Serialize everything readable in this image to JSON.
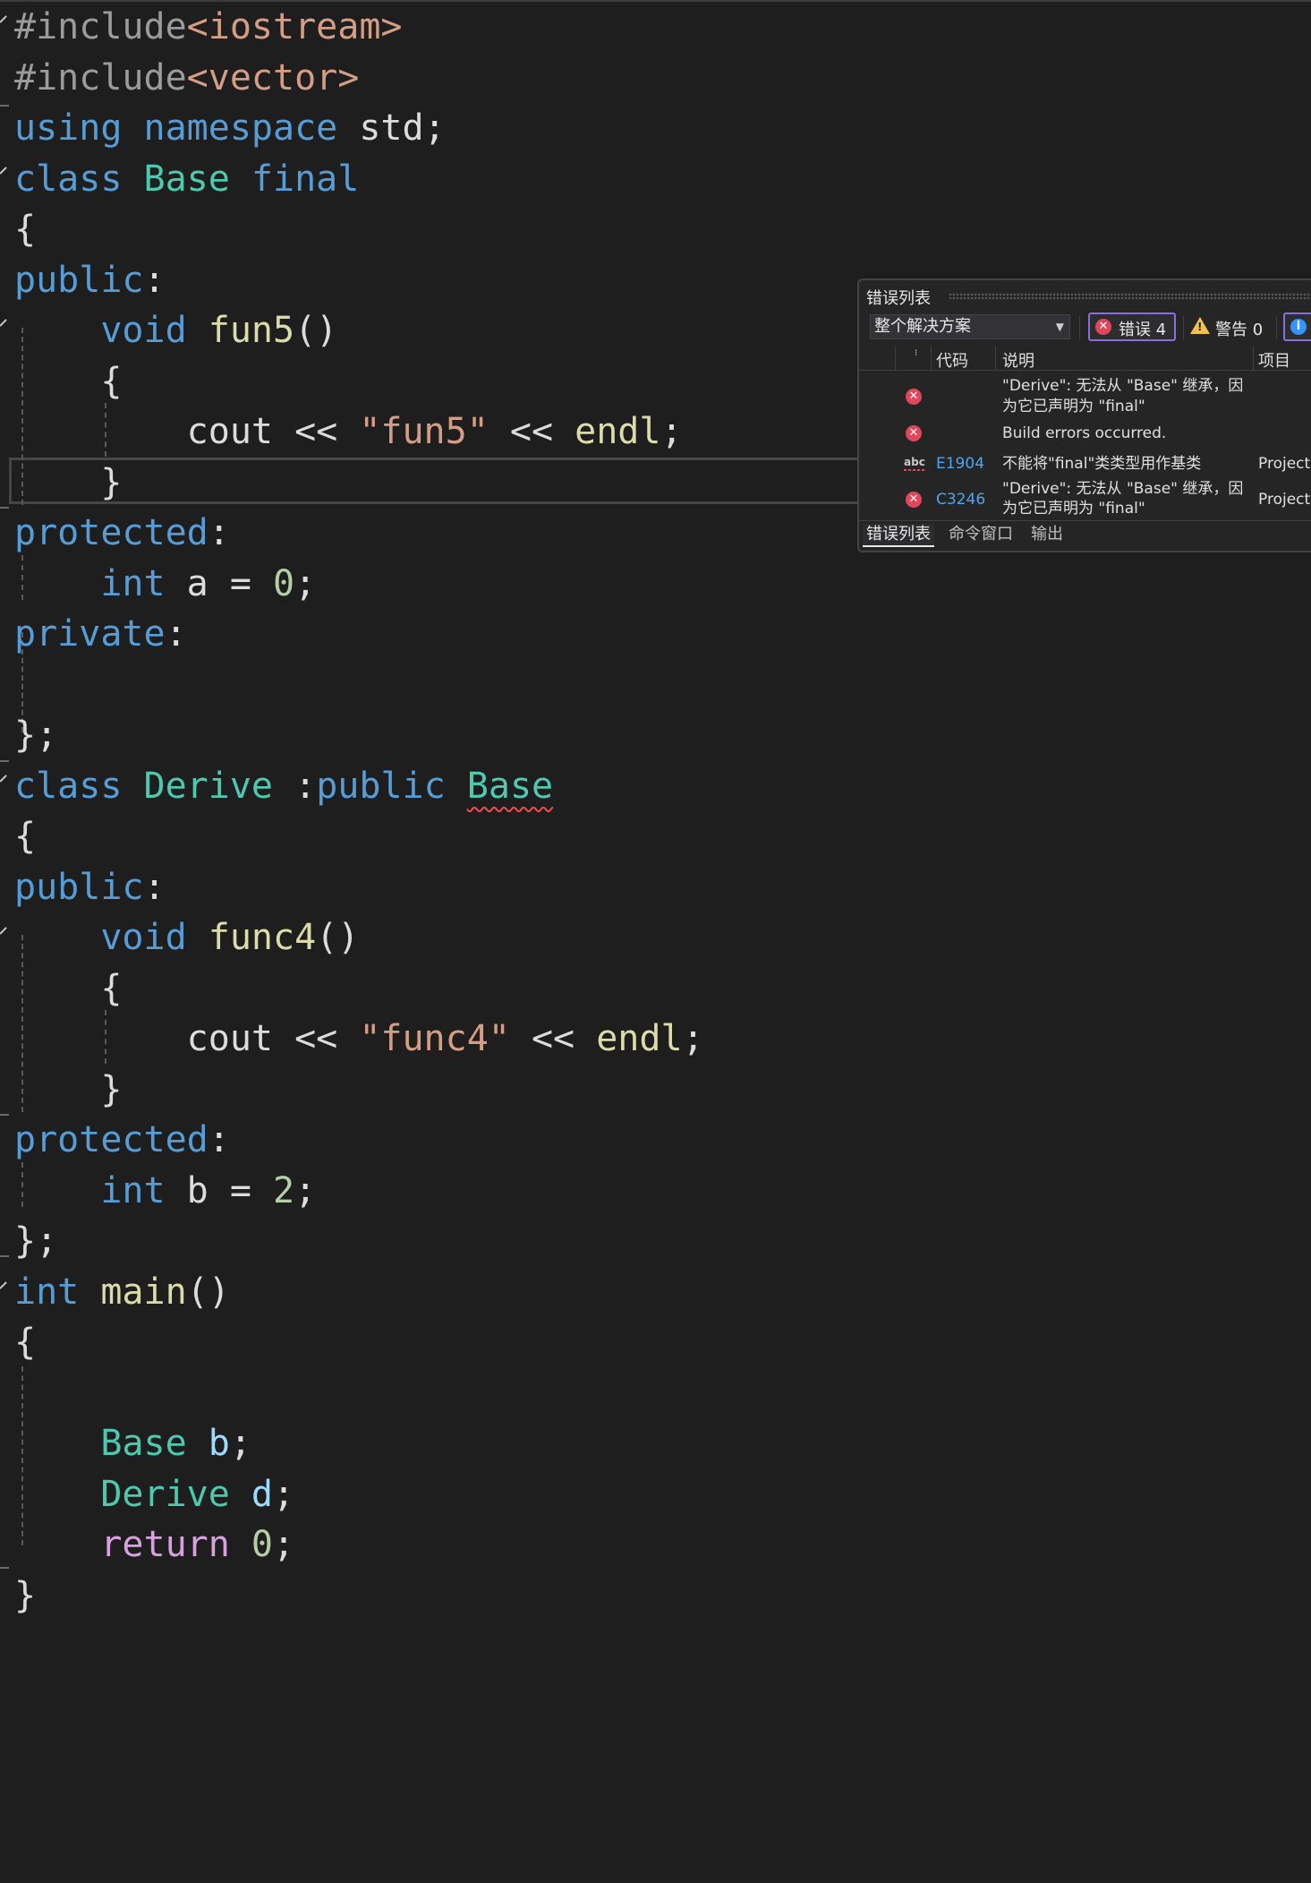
{
  "editor": {
    "lines": [
      {
        "tokens": [
          {
            "c": "p",
            "t": "#include"
          },
          {
            "c": "s",
            "t": "<iostream>"
          }
        ]
      },
      {
        "tokens": [
          {
            "c": "p",
            "t": "#include"
          },
          {
            "c": "s",
            "t": "<vector>"
          }
        ]
      },
      {
        "tokens": [
          {
            "c": "k",
            "t": "using"
          },
          {
            "c": "",
            "t": " "
          },
          {
            "c": "k",
            "t": "namespace"
          },
          {
            "c": "",
            "t": " std;"
          }
        ]
      },
      {
        "tokens": [
          {
            "c": "k",
            "t": "class"
          },
          {
            "c": "",
            "t": " "
          },
          {
            "c": "t",
            "t": "Base"
          },
          {
            "c": "",
            "t": " "
          },
          {
            "c": "k",
            "t": "final"
          }
        ]
      },
      {
        "tokens": [
          {
            "c": "",
            "t": "{"
          }
        ]
      },
      {
        "tokens": [
          {
            "c": "k",
            "t": "public"
          },
          {
            "c": "",
            "t": ":"
          }
        ]
      },
      {
        "tokens": [
          {
            "c": "",
            "t": "    "
          },
          {
            "c": "k",
            "t": "void"
          },
          {
            "c": "",
            "t": " "
          },
          {
            "c": "f",
            "t": "fun5"
          },
          {
            "c": "",
            "t": "()"
          }
        ]
      },
      {
        "tokens": [
          {
            "c": "",
            "t": "    {"
          }
        ]
      },
      {
        "tokens": [
          {
            "c": "",
            "t": "        cout << "
          },
          {
            "c": "s",
            "t": "\"fun5\""
          },
          {
            "c": "",
            "t": " << "
          },
          {
            "c": "f",
            "t": "endl"
          },
          {
            "c": "",
            "t": ";"
          }
        ]
      },
      {
        "tokens": [
          {
            "c": "",
            "t": "    }"
          }
        ]
      },
      {
        "tokens": [
          {
            "c": "k",
            "t": "protected"
          },
          {
            "c": "",
            "t": ":"
          }
        ]
      },
      {
        "tokens": [
          {
            "c": "",
            "t": "    "
          },
          {
            "c": "k",
            "t": "int"
          },
          {
            "c": "",
            "t": " a = "
          },
          {
            "c": "n",
            "t": "0"
          },
          {
            "c": "",
            "t": ";"
          }
        ]
      },
      {
        "tokens": [
          {
            "c": "k",
            "t": "private"
          },
          {
            "c": "",
            "t": ":"
          }
        ]
      },
      {
        "tokens": []
      },
      {
        "tokens": [
          {
            "c": "",
            "t": "};"
          }
        ]
      },
      {
        "tokens": [
          {
            "c": "k",
            "t": "class"
          },
          {
            "c": "",
            "t": " "
          },
          {
            "c": "t",
            "t": "Derive"
          },
          {
            "c": "",
            "t": " :"
          },
          {
            "c": "k",
            "t": "public"
          },
          {
            "c": "",
            "t": " "
          },
          {
            "c": "t squiggle",
            "t": "Base"
          }
        ]
      },
      {
        "tokens": [
          {
            "c": "",
            "t": "{"
          }
        ]
      },
      {
        "tokens": [
          {
            "c": "k",
            "t": "public"
          },
          {
            "c": "",
            "t": ":"
          }
        ]
      },
      {
        "tokens": [
          {
            "c": "",
            "t": "    "
          },
          {
            "c": "k",
            "t": "void"
          },
          {
            "c": "",
            "t": " "
          },
          {
            "c": "f",
            "t": "func4"
          },
          {
            "c": "",
            "t": "()"
          }
        ]
      },
      {
        "tokens": [
          {
            "c": "",
            "t": "    {"
          }
        ]
      },
      {
        "tokens": [
          {
            "c": "",
            "t": "        cout << "
          },
          {
            "c": "s",
            "t": "\"func4\""
          },
          {
            "c": "",
            "t": " << "
          },
          {
            "c": "f",
            "t": "endl"
          },
          {
            "c": "",
            "t": ";"
          }
        ]
      },
      {
        "tokens": [
          {
            "c": "",
            "t": "    }"
          }
        ]
      },
      {
        "tokens": [
          {
            "c": "k",
            "t": "protected"
          },
          {
            "c": "",
            "t": ":"
          }
        ]
      },
      {
        "tokens": [
          {
            "c": "",
            "t": "    "
          },
          {
            "c": "k",
            "t": "int"
          },
          {
            "c": "",
            "t": " b = "
          },
          {
            "c": "n",
            "t": "2"
          },
          {
            "c": "",
            "t": ";"
          }
        ]
      },
      {
        "tokens": [
          {
            "c": "",
            "t": "};"
          }
        ]
      },
      {
        "tokens": [
          {
            "c": "k",
            "t": "int"
          },
          {
            "c": "",
            "t": " "
          },
          {
            "c": "f",
            "t": "main"
          },
          {
            "c": "",
            "t": "()"
          }
        ]
      },
      {
        "tokens": [
          {
            "c": "",
            "t": "{"
          }
        ]
      },
      {
        "tokens": []
      },
      {
        "tokens": [
          {
            "c": "",
            "t": "    "
          },
          {
            "c": "t",
            "t": "Base"
          },
          {
            "c": "",
            "t": " "
          },
          {
            "c": "v",
            "t": "b"
          },
          {
            "c": "",
            "t": ";"
          }
        ]
      },
      {
        "tokens": [
          {
            "c": "",
            "t": "    "
          },
          {
            "c": "t",
            "t": "Derive"
          },
          {
            "c": "",
            "t": " "
          },
          {
            "c": "v",
            "t": "d"
          },
          {
            "c": "",
            "t": ";"
          }
        ]
      },
      {
        "tokens": [
          {
            "c": "",
            "t": "    "
          },
          {
            "c": "r",
            "t": "return"
          },
          {
            "c": "",
            "t": " "
          },
          {
            "c": "n",
            "t": "0"
          },
          {
            "c": "",
            "t": ";"
          }
        ]
      },
      {
        "tokens": [
          {
            "c": "",
            "t": "}"
          }
        ]
      }
    ]
  },
  "error_list": {
    "title": "错误列表",
    "scope": "整个解决方案",
    "errors_label": "错误 4",
    "warnings_label": "警告 0",
    "info_icon": "i",
    "columns": {
      "code": "代码",
      "description": "说明",
      "project": "项目"
    },
    "rows": [
      {
        "icon": "error-icon",
        "code": "",
        "desc1": "\"Derive\": 无法从 \"Base\" 继承，因",
        "desc2": "为它已声明为 \"final\"",
        "project": ""
      },
      {
        "icon": "error-icon",
        "code": "",
        "desc1": "Build errors occurred.",
        "desc2": "",
        "project": ""
      },
      {
        "icon": "spell-check-icon",
        "code": "E1904",
        "desc1": "不能将\"final\"类类型用作基类",
        "desc2": "",
        "project": "Project"
      },
      {
        "icon": "error-icon",
        "code": "C3246",
        "desc1": "\"Derive\": 无法从 \"Base\" 继承，因",
        "desc2": "为它已声明为 \"final\"",
        "project": "Project"
      }
    ],
    "tabs": [
      "错误列表",
      "命令窗口",
      "输出"
    ]
  }
}
